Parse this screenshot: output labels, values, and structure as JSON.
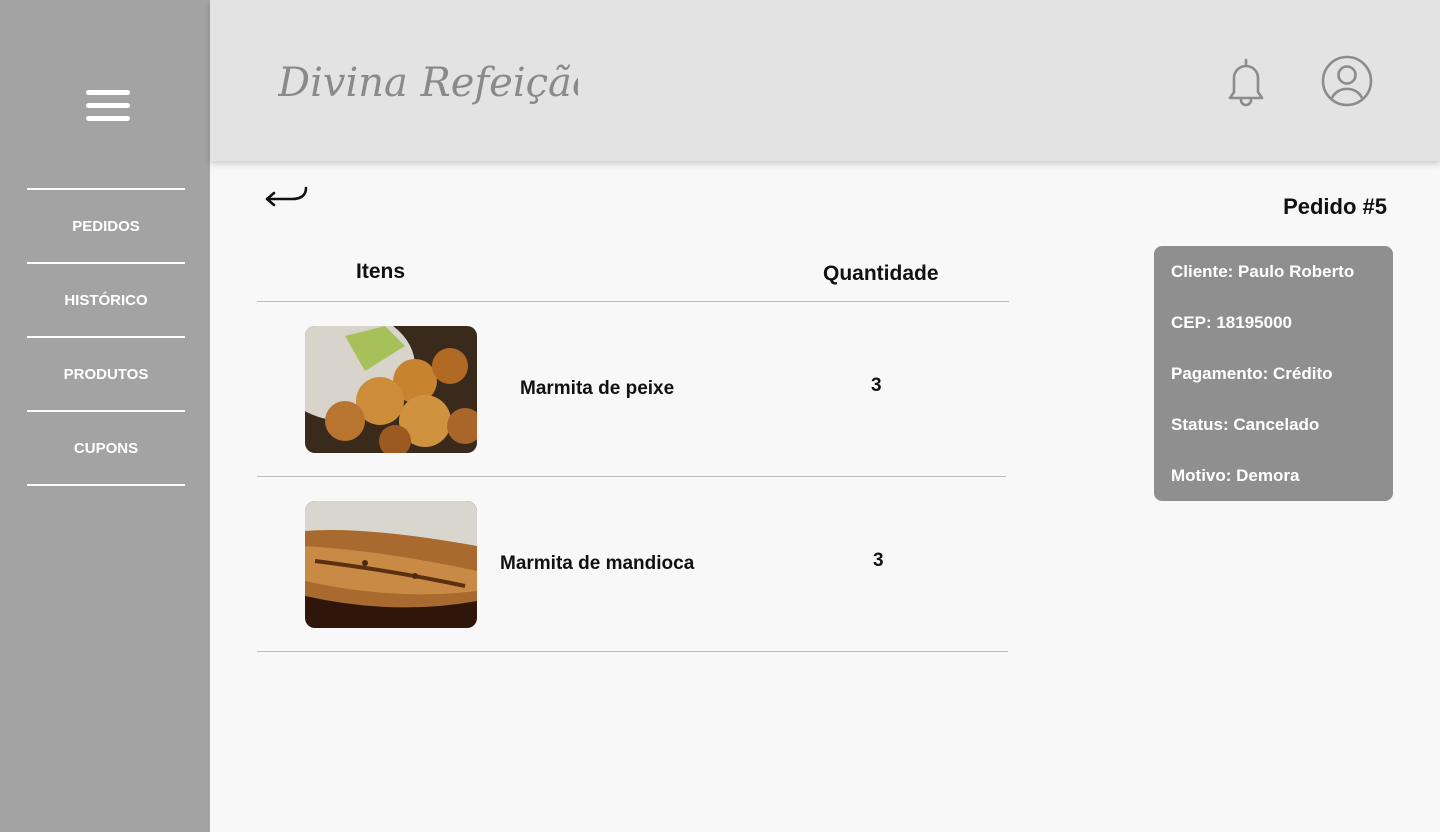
{
  "sidebar": {
    "items": [
      {
        "label": "PEDIDOS"
      },
      {
        "label": "HISTÓRICO"
      },
      {
        "label": "PRODUTOS"
      },
      {
        "label": "CUPONS"
      }
    ]
  },
  "header": {
    "logo_text": "Divina Refeição"
  },
  "order": {
    "title": "Pedido #5"
  },
  "table": {
    "col_items": "Itens",
    "col_qty": "Quantidade",
    "rows": [
      {
        "name": "Marmita de peixe",
        "qty": "3"
      },
      {
        "name": "Marmita de mandioca",
        "qty": "3"
      }
    ]
  },
  "info": {
    "cliente": "Cliente: Paulo Roberto",
    "cep": "CEP: 18195000",
    "pagamento": "Pagamento: Crédito",
    "status": "Status: Cancelado",
    "motivo": "Motivo: Demora"
  },
  "colors": {
    "sidebar": "#a3a3a3",
    "header": "#e3e3e3",
    "card": "#8f8f8f"
  }
}
